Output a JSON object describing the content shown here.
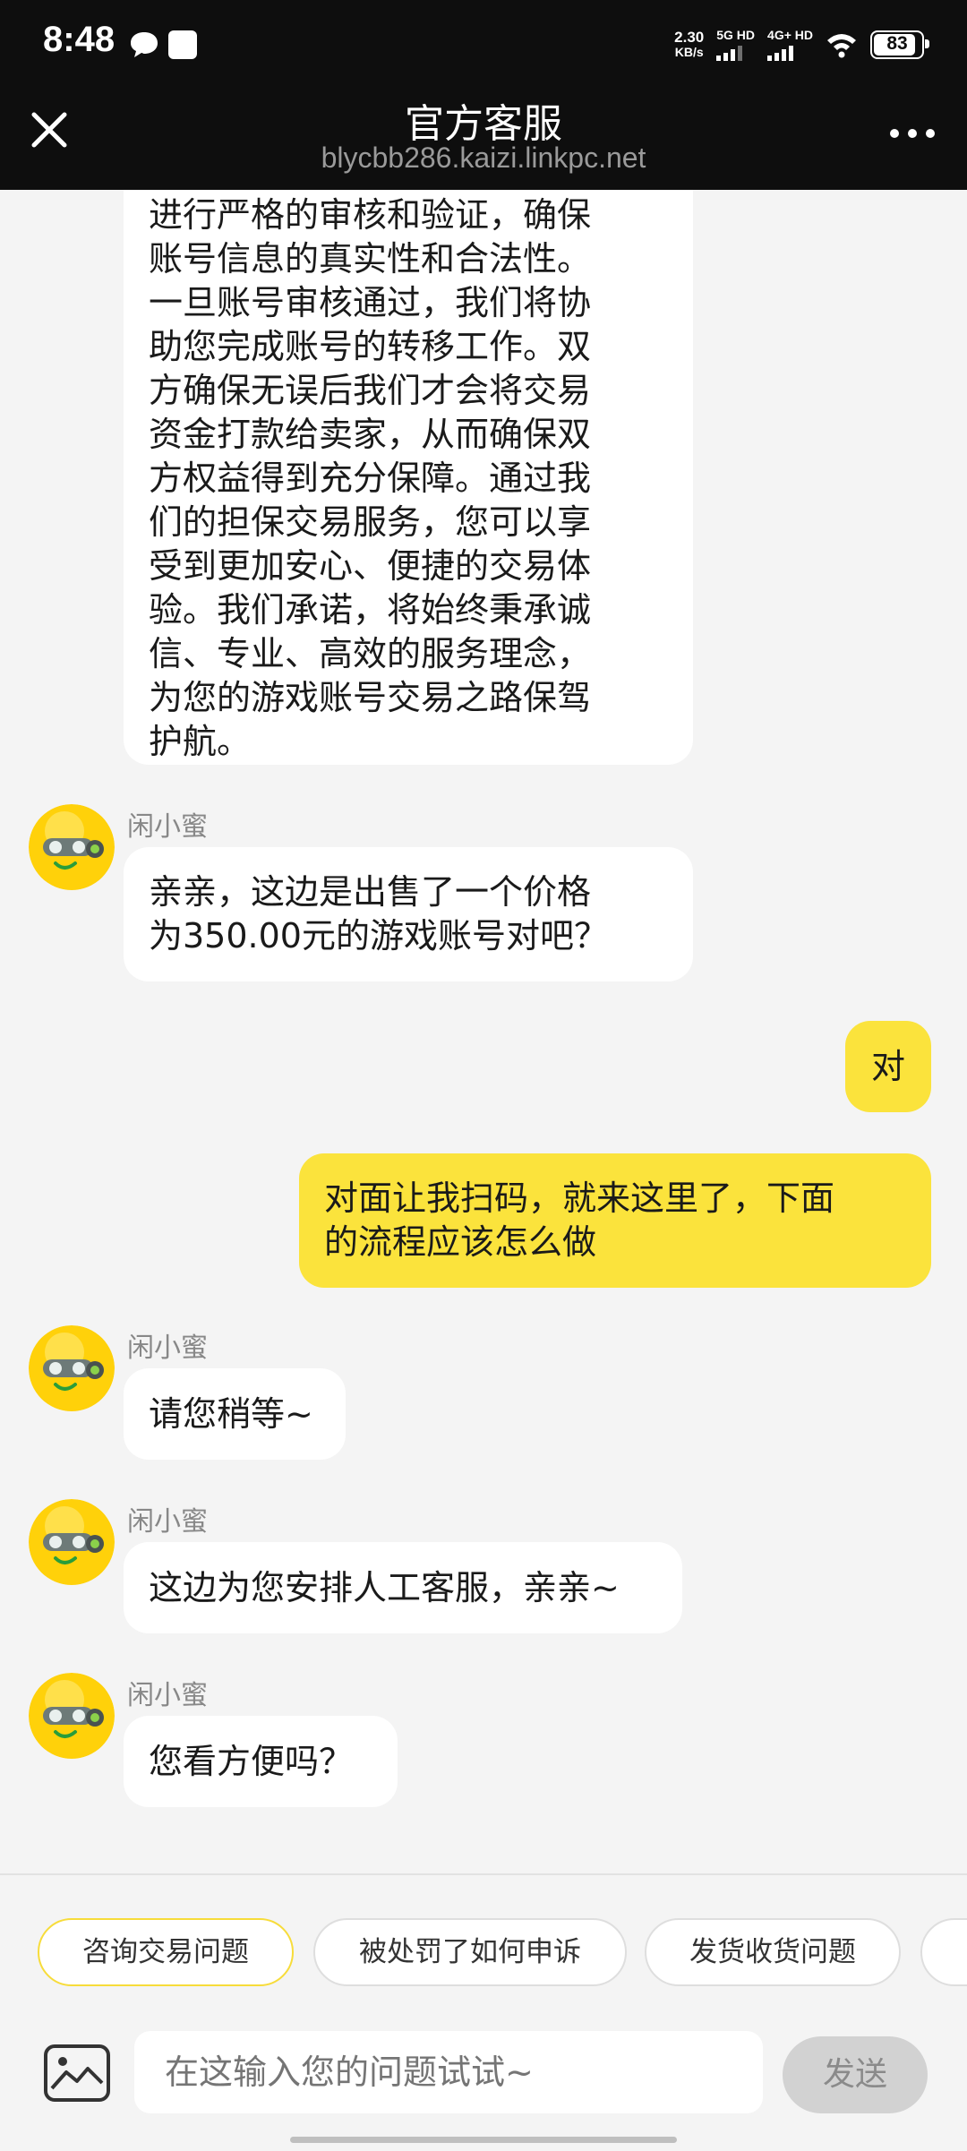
{
  "status_bar": {
    "time": "8:48",
    "net_speed": "2.30",
    "net_unit": "KB/s",
    "sim1_label": "5G HD",
    "sim2_label": "4G+ HD",
    "battery": "83",
    "icons": [
      "chat-bubble-icon",
      "square-notification-icon",
      "wifi-icon",
      "battery-icon"
    ]
  },
  "header": {
    "title": "官方客服",
    "subtitle": "blycbb286.kaizi.linkpc.net",
    "icons": [
      "close-icon",
      "more-icon"
    ]
  },
  "messages": [
    {
      "side": "left",
      "sender": "",
      "lines": [
        "进行严格的审核和验证，确保",
        "账号信息的真实性和合法性。",
        "一旦账号审核通过，我们将协",
        "助您完成账号的转移工作。双",
        "方确保无误后我们才会将交易",
        "资金打款给卖家，从而确保双",
        "方权益得到充分保障。通过我",
        "们的担保交易服务，您可以享",
        "受到更加安心、便捷的交易体",
        "验。我们承诺，将始终秉承诚",
        "信、专业、高效的服务理念，",
        "为您的游戏账号交易之路保驾",
        "护航。"
      ]
    },
    {
      "side": "left",
      "sender": "闲小蜜",
      "lines": [
        "亲亲，这边是出售了一个价格",
        "为350.00元的游戏账号对吧？"
      ]
    },
    {
      "side": "right",
      "sender": "",
      "lines": [
        "对"
      ]
    },
    {
      "side": "right",
      "sender": "",
      "lines": [
        "对面让我扫码，就来这里了，下面",
        "的流程应该怎么做"
      ]
    },
    {
      "side": "left",
      "sender": "闲小蜜",
      "lines": [
        "请您稍等~"
      ]
    },
    {
      "side": "left",
      "sender": "闲小蜜",
      "lines": [
        "这边为您安排人工客服，亲亲~"
      ]
    },
    {
      "side": "left",
      "sender": "闲小蜜",
      "lines": [
        "您看方便吗？"
      ]
    }
  ],
  "quick_replies": [
    "咨询交易问题",
    "被处罚了如何申诉",
    "发货收货问题"
  ],
  "input": {
    "placeholder": "在这输入您的问题试试~"
  },
  "send_label": "发送",
  "colors": {
    "user_bubble": "#fbe33c",
    "header_bg": "#0e0e0e",
    "page_bg": "#f4f4f4",
    "active_chip_border": "#f7dc3a"
  }
}
